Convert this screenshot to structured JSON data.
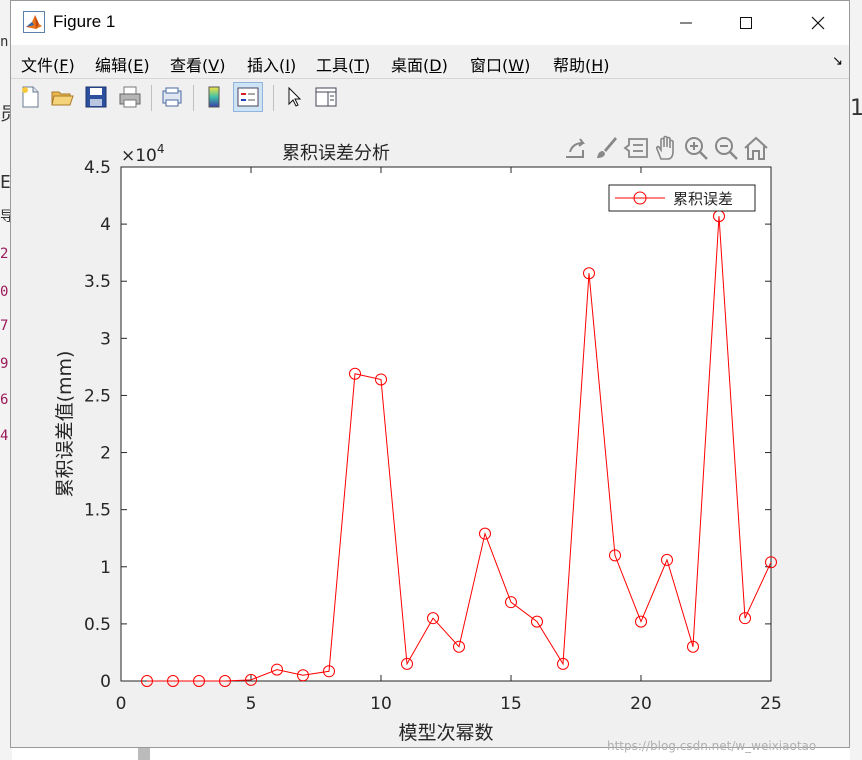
{
  "window": {
    "title": "Figure 1"
  },
  "background": {
    "left_chars": [
      "n",
      "员",
      "E",
      "导",
      "2",
      "0",
      "7",
      "9",
      "6",
      "4"
    ],
    "right_char": "1"
  },
  "menu": [
    {
      "label": "文件(",
      "key": "F",
      "end": ")"
    },
    {
      "label": "编辑(",
      "key": "E",
      "end": ")"
    },
    {
      "label": "查看(",
      "key": "V",
      "end": ")"
    },
    {
      "label": "插入(",
      "key": "I",
      "end": ")"
    },
    {
      "label": "工具(",
      "key": "T",
      "end": ")"
    },
    {
      "label": "桌面(",
      "key": "D",
      "end": ")"
    },
    {
      "label": "窗口(",
      "key": "W",
      "end": ")"
    },
    {
      "label": "帮助(",
      "key": "H",
      "end": ")"
    }
  ],
  "toolbar": [
    "new-figure-icon",
    "open-file-icon",
    "save-icon",
    "print-icon",
    "print-preview-icon",
    "colorbar-icon",
    "legend-icon",
    "pointer-icon",
    "property-editor-icon"
  ],
  "axes_toolbar": [
    "export-icon",
    "brush-icon",
    "data-tips-icon",
    "pan-icon",
    "zoom-in-icon",
    "zoom-out-icon",
    "home-icon"
  ],
  "chart_data": {
    "type": "line",
    "title": "累积误差分析",
    "xlabel": "模型次幂数",
    "ylabel": "累积误差值(mm)",
    "exponent_label": "×10",
    "exponent_power": "4",
    "xlim": [
      0,
      25
    ],
    "ylim": [
      0,
      45000
    ],
    "xticks": [
      0,
      5,
      10,
      15,
      20,
      25
    ],
    "yticks": [
      0,
      5000,
      10000,
      15000,
      20000,
      25000,
      30000,
      35000,
      40000,
      45000
    ],
    "ytick_labels": [
      "0",
      "0.5",
      "1",
      "1.5",
      "2",
      "2.5",
      "3",
      "3.5",
      "4",
      "4.5"
    ],
    "grid": false,
    "legend_position": "top-right",
    "series": [
      {
        "name": "累积误差",
        "color": "#ff0000",
        "marker": "circle",
        "x": [
          1,
          2,
          3,
          4,
          5,
          6,
          7,
          8,
          9,
          10,
          11,
          12,
          13,
          14,
          15,
          16,
          17,
          18,
          19,
          20,
          21,
          22,
          23,
          24,
          25
        ],
        "y": [
          0,
          0,
          0,
          0,
          100,
          1000,
          500,
          850,
          26900,
          26400,
          1500,
          5500,
          3000,
          12900,
          6900,
          5200,
          1500,
          35700,
          11000,
          5200,
          10600,
          3000,
          40700,
          5500,
          10400
        ]
      }
    ]
  },
  "watermark": "https://blog.csdn.net/w_weixiaotao"
}
